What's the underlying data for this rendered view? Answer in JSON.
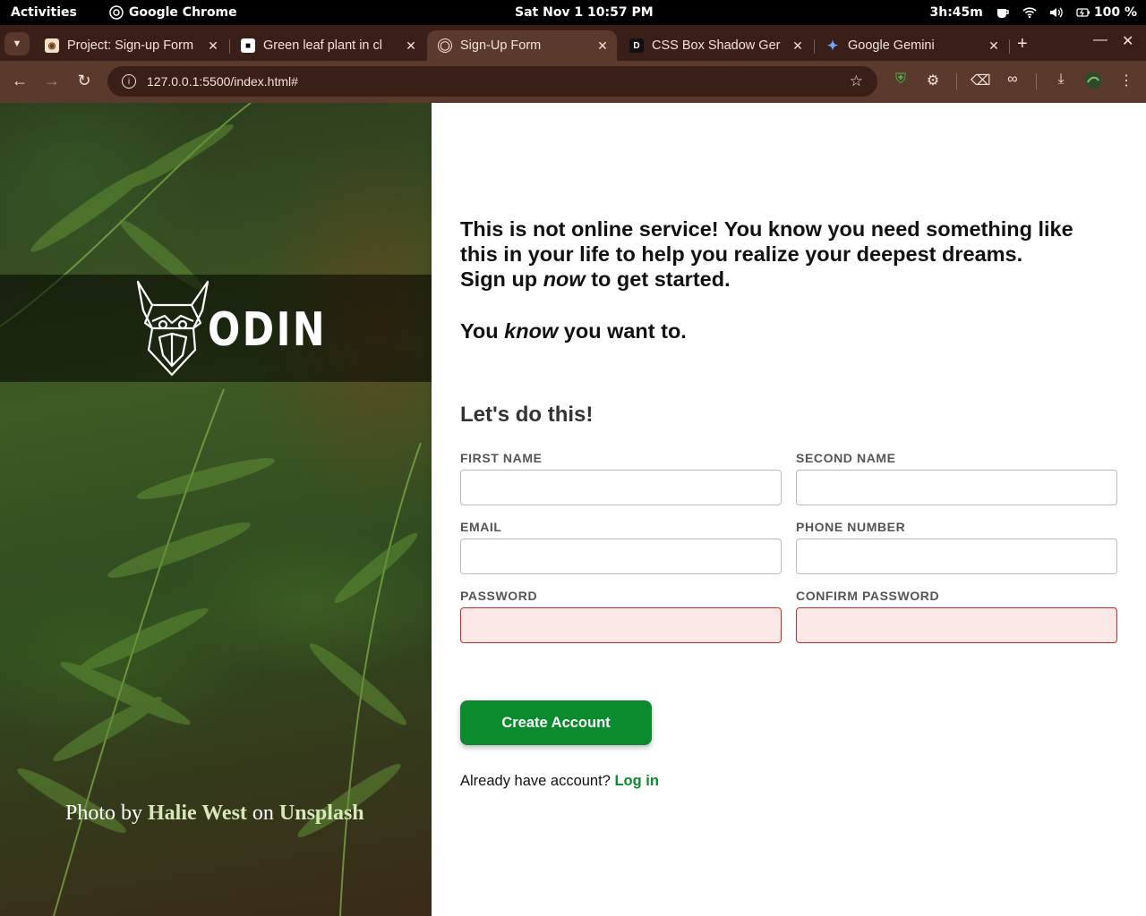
{
  "system_bar": {
    "activities": "Activities",
    "app_name": "Google Chrome",
    "clock": "Sat Nov 1  10:57 PM",
    "battery_time": "3h:45m",
    "battery_percent": "100 %"
  },
  "browser": {
    "tabs": [
      {
        "title": "Project: Sign-up Form",
        "favicon": "odin-favicon",
        "active": false
      },
      {
        "title": "Green leaf plant in cl",
        "favicon": "unsplash-favicon",
        "active": false
      },
      {
        "title": "Sign-Up Form",
        "favicon": "globe-icon",
        "active": true
      },
      {
        "title": "CSS Box Shadow Ger",
        "favicon": "cssgen-favicon",
        "active": false
      },
      {
        "title": "Google Gemini",
        "favicon": "gemini-icon",
        "active": false
      }
    ],
    "url": "127.0.0.1:5500/index.html#",
    "colors": {
      "frame": "#3a1f18",
      "toolbar": "#5b3a2e"
    }
  },
  "hero": {
    "logo_text": "ODIN",
    "credit_prefix": "Photo by ",
    "credit_author": "Halie West",
    "credit_mid": " on ",
    "credit_site": "Unsplash"
  },
  "intro": {
    "line1": "This is not online service! You know you need something like this in your life to help you realize your deepest dreams.",
    "line2_pre": "Sign up ",
    "line2_em": "now",
    "line2_post": " to get started.",
    "line3_pre": "You ",
    "line3_em": "know",
    "line3_post": " you want to."
  },
  "form": {
    "title": "Let's do this!",
    "fields": {
      "first_name": {
        "label": "FIRST NAME",
        "value": ""
      },
      "second_name": {
        "label": "SECOND NAME",
        "value": ""
      },
      "email": {
        "label": "EMAIL",
        "value": ""
      },
      "phone": {
        "label": "PHONE NUMBER",
        "value": ""
      },
      "password": {
        "label": "PASSWORD",
        "value": "",
        "invalid": true
      },
      "confirm_password": {
        "label": "CONFIRM PASSWORD",
        "value": "",
        "invalid": true
      }
    },
    "submit_label": "Create Account",
    "login_prompt": "Already have account? ",
    "login_link": "Log in",
    "accent_color": "#0b8a2e",
    "error_color": "#cc2a2a"
  }
}
